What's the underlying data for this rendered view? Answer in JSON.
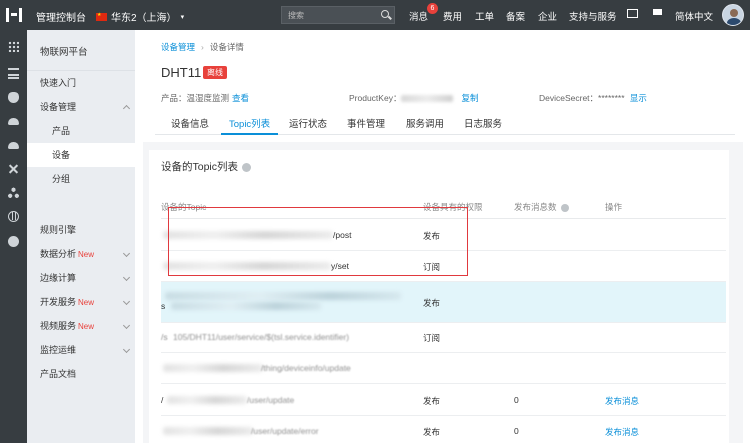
{
  "topbar": {
    "console": "管理控制台",
    "region": "华东2（上海）",
    "search_placeholder": "搜索",
    "nav": {
      "messages": "消息",
      "message_count": "6",
      "billing": "费用",
      "ticket": "工单",
      "beian": "备案",
      "enterprise": "企业",
      "support": "支持与服务",
      "language": "简体中文"
    },
    "icons": [
      "mail-icon",
      "cart-icon"
    ]
  },
  "rail_icons": [
    "grid-icon",
    "list-icon",
    "shield-icon",
    "cloud-icon",
    "database-icon",
    "close-x-icon",
    "nodes-icon",
    "globe-icon",
    "circle-icon"
  ],
  "sidebar": {
    "title": "物联网平台",
    "items": [
      {
        "label": "快速入门"
      },
      {
        "label": "设备管理"
      },
      {
        "label": "产品"
      },
      {
        "label": "设备"
      },
      {
        "label": "分组"
      },
      {
        "label": "规则引擎"
      },
      {
        "label": "数据分析",
        "badge": "New"
      },
      {
        "label": "边缘计算"
      },
      {
        "label": "开发服务",
        "badge": "New"
      },
      {
        "label": "视频服务",
        "badge": "New"
      },
      {
        "label": "监控运维"
      },
      {
        "label": "产品文档"
      }
    ]
  },
  "breadcrumb": {
    "parent": "设备管理",
    "separator": "›",
    "current": "设备详情"
  },
  "device": {
    "name": "DHT11",
    "status": "离线",
    "product_label": "产品：温湿度监测",
    "product_link": "查看",
    "productkey_label": "ProductKey：",
    "copy_link": "复制",
    "devicesecret_label": "DeviceSecret：******** ",
    "show_link": "显示"
  },
  "tabs": [
    "设备信息",
    "Topic列表",
    "运行状态",
    "事件管理",
    "服务调用",
    "日志服务"
  ],
  "active_tab": "Topic列表",
  "topic_table": {
    "title": "设备的Topic列表",
    "headers": {
      "topic": "设备的Topic",
      "permission": "设备具有的权限",
      "published": "发布消息数",
      "action": "操作"
    },
    "rows": [
      {
        "topic_suffix": "/post",
        "permission": "发布",
        "count": "",
        "action": ""
      },
      {
        "topic_suffix": "y/set",
        "permission": "订阅",
        "count": "",
        "action": ""
      },
      {
        "topic_prefix": "s",
        "topic_suffix": "",
        "permission": "发布",
        "count": "",
        "action": ""
      },
      {
        "topic_prefix": "/s",
        "topic_mid": "105/DHT11/user/service/$(tsl.service.identifier)",
        "permission": "订阅",
        "count": "",
        "action": ""
      },
      {
        "topic_mid": "/thing/deviceinfo/update",
        "permission": "发布",
        "count": "",
        "action": ""
      },
      {
        "topic_prefix": "/",
        "topic_mid": "/user/update",
        "permission": "发布",
        "count": "0",
        "action": "发布消息"
      },
      {
        "topic_mid": "/user/update/error",
        "permission": "发布",
        "count": "0",
        "action": "发布消息"
      }
    ]
  },
  "colors": {
    "topbar_bg": "#373d41",
    "accent": "#0a8fd8",
    "danger": "#e8413b",
    "highlight_row": "#e2f5fa"
  }
}
